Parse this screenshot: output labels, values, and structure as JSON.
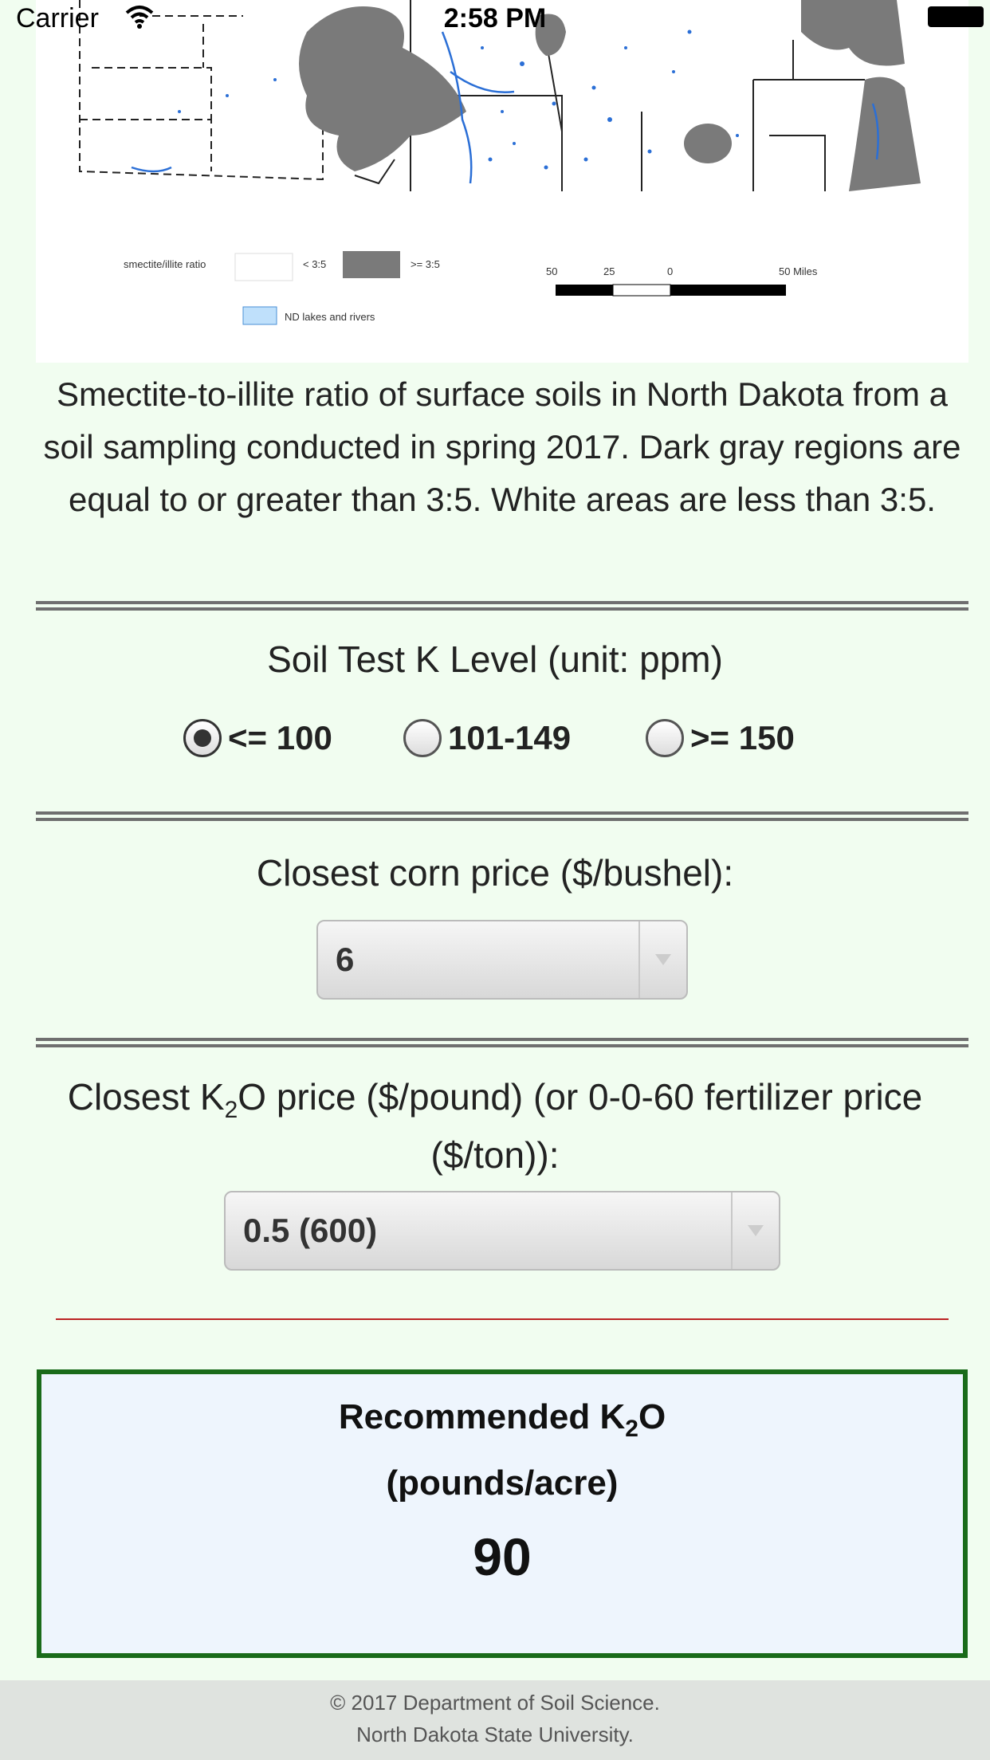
{
  "status_bar": {
    "carrier": "Carrier",
    "time": "2:58 PM"
  },
  "map": {
    "legend_ratio_label": "smectite/illite ratio",
    "legend_low": "< 3:5",
    "legend_high": ">= 3:5",
    "legend_water": "ND lakes and rivers",
    "scale_labels": [
      "50",
      "25",
      "0",
      "50 Miles"
    ],
    "colors": {
      "high_ratio": "#7a7a7a",
      "water": "#2b6fd6"
    }
  },
  "caption": "Smectite-to-illite ratio of surface soils in North Dakota from a soil sampling conducted in spring 2017. Dark gray regions are equal to or greater than 3:5. White areas are less than 3:5.",
  "soil_test": {
    "heading": "Soil Test K Level (unit: ppm)",
    "options": [
      {
        "label": "<= 100",
        "checked": true
      },
      {
        "label": "101-149",
        "checked": false
      },
      {
        "label": ">= 150",
        "checked": false
      }
    ]
  },
  "corn_price": {
    "heading": "Closest corn price ($/bushel):",
    "selected": "6"
  },
  "k2o_price": {
    "heading_prefix": "Closest K",
    "heading_sub": "2",
    "heading_suffix": "O price ($/pound) (or 0-0-60 fertilizer price ($/ton)):",
    "selected": "0.5 (600)"
  },
  "result": {
    "title_prefix": "Recommended K",
    "title_sub": "2",
    "title_suffix": "O",
    "unit": "(pounds/acre)",
    "value": "90"
  },
  "footer": {
    "line1": "© 2017 Department of Soil Science.",
    "line2": "North Dakota State University."
  }
}
